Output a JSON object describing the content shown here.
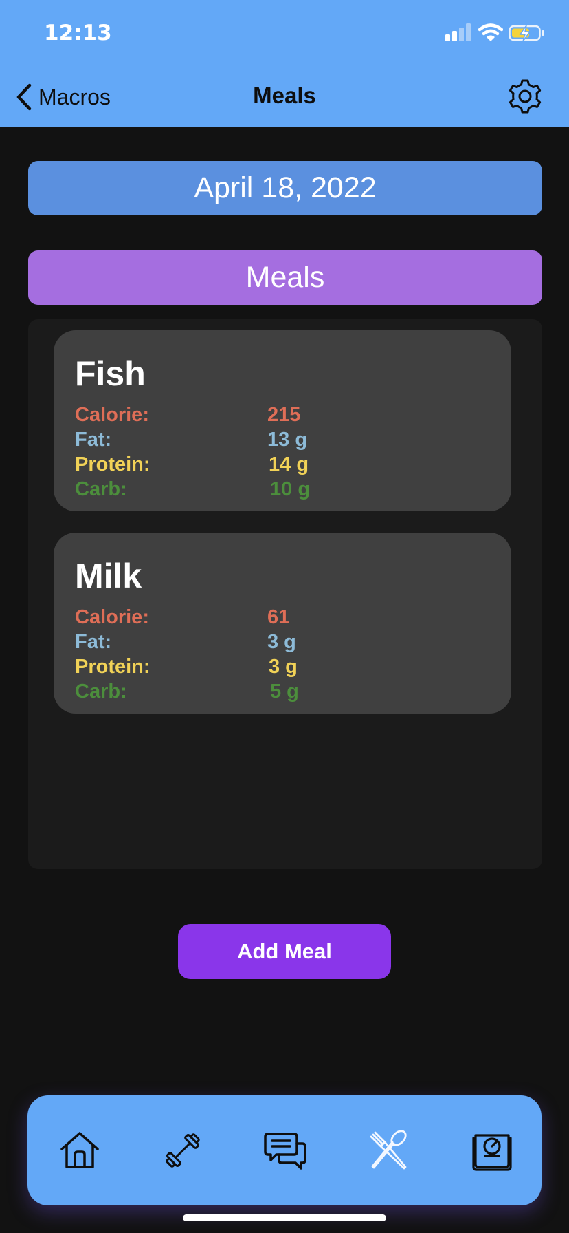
{
  "status_bar": {
    "time": "12:13"
  },
  "nav": {
    "back_label": "Macros",
    "title": "Meals",
    "settings_icon": "gear-icon"
  },
  "date": "April 18, 2022",
  "section_title": "Meals",
  "meals": [
    {
      "name": "Fish",
      "calorie_label": "Calorie:",
      "calorie": "215",
      "fat_label": "Fat:",
      "fat": "13 g",
      "protein_label": "Protein:",
      "protein": "14 g",
      "carb_label": "Carb:",
      "carb": "10 g"
    },
    {
      "name": "Milk",
      "calorie_label": "Calorie:",
      "calorie": "61",
      "fat_label": "Fat:",
      "fat": "3 g",
      "protein_label": "Protein:",
      "protein": "3 g",
      "carb_label": "Carb:",
      "carb": "5 g"
    }
  ],
  "add_button": "Add Meal",
  "tabbar": {
    "items": [
      "home-icon",
      "dumbbell-icon",
      "chat-icon",
      "fork-spoon-icon",
      "scale-icon"
    ],
    "active": "fork-spoon-icon"
  },
  "colors": {
    "header": "#63a8f7",
    "date_bar": "#5b90df",
    "section_bar": "#a56ee0",
    "add_button": "#8a36ea",
    "calorie": "#df6e57",
    "fat": "#8dbbd8",
    "protein": "#f1d257",
    "carb": "#4c8e3c"
  }
}
